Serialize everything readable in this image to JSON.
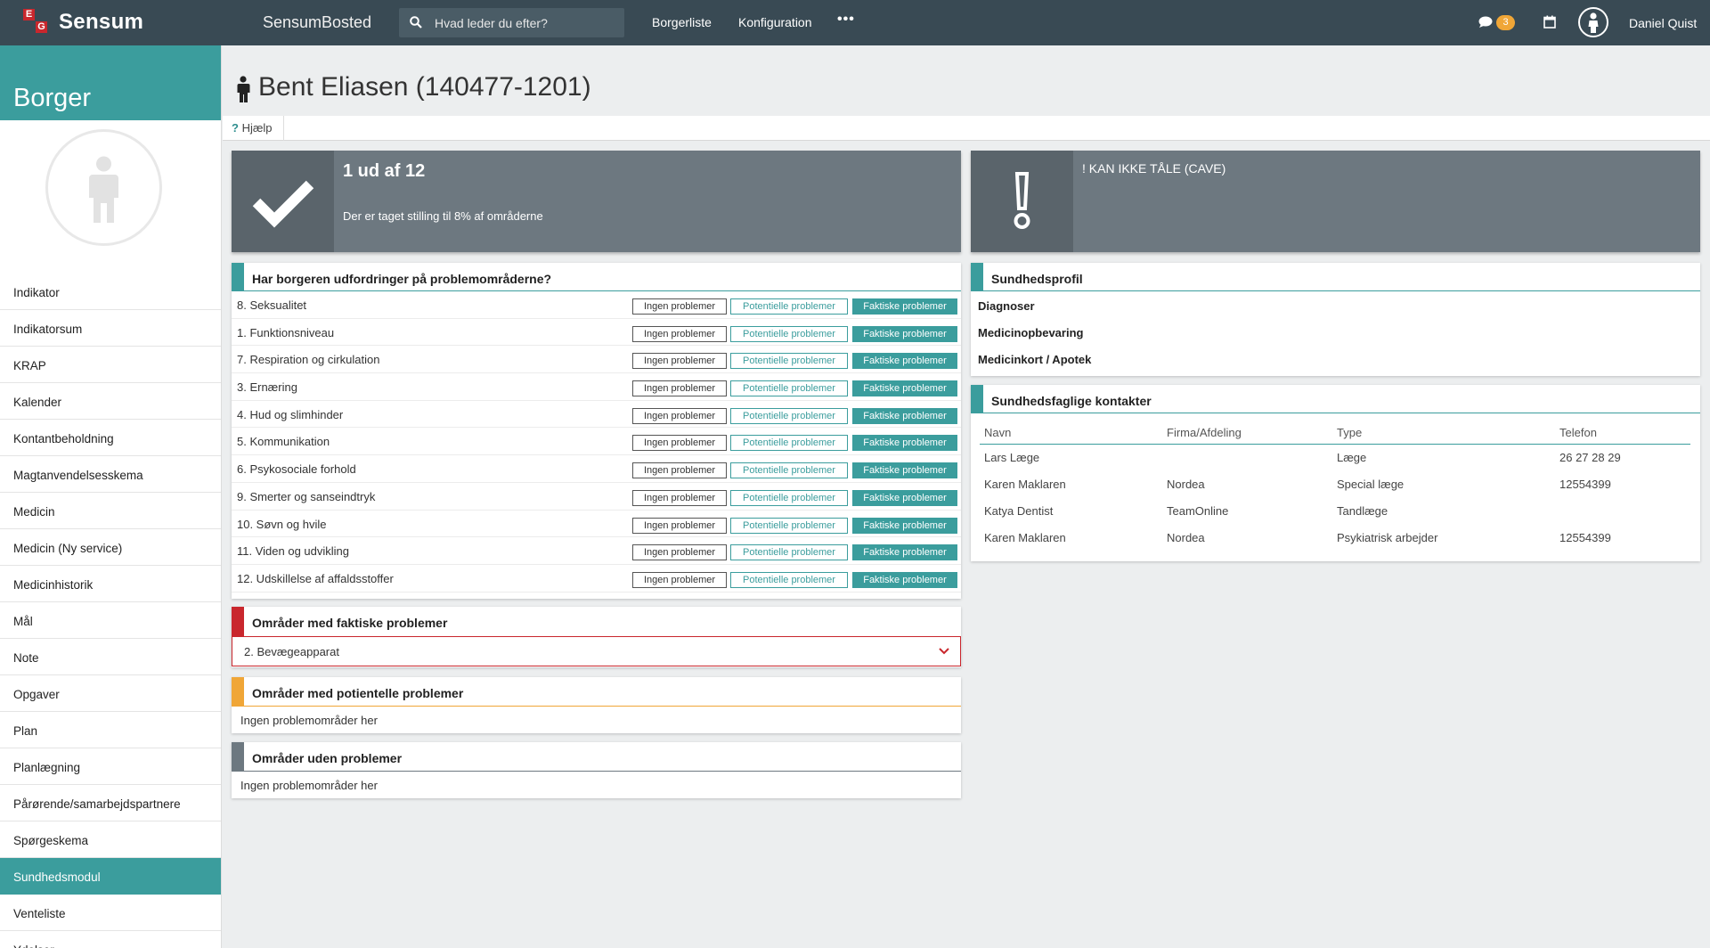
{
  "topbar": {
    "brand": "Sensum",
    "app_title": "SensumBosted",
    "search_placeholder": "Hvad leder du efter?",
    "nav": [
      "Borgerliste",
      "Konfiguration"
    ],
    "more": "•••",
    "messages_count": "3",
    "username": "Daniel Quist"
  },
  "sidebar": {
    "heading": "Borger",
    "items": [
      "Indikator",
      "Indikatorsum",
      "KRAP",
      "Kalender",
      "Kontantbeholdning",
      "Magtanvendelsesskema",
      "Medicin",
      "Medicin (Ny service)",
      "Medicinhistorik",
      "Mål",
      "Note",
      "Opgaver",
      "Plan",
      "Planlægning",
      "Pårørende/samarbejdspartnere",
      "Spørgeskema",
      "Sundhedsmodul",
      "Venteliste",
      "Ydelser"
    ],
    "active": "Sundhedsmodul"
  },
  "page": {
    "title": "Bent Eliasen (140477-1201)",
    "help": "Hjælp"
  },
  "stat_left": {
    "big": "1 ud af 12",
    "small": "Der er taget stilling til 8% af områderne"
  },
  "stat_right": {
    "text": "! KAN IKKE TÅLE (CAVE)"
  },
  "problems": {
    "title": "Har borgeren udfordringer på problemområderne?",
    "btn_none": "Ingen problemer",
    "btn_pot": "Potentielle problemer",
    "btn_act": "Faktiske problemer",
    "rows": [
      "8. Seksualitet",
      "1. Funktionsniveau",
      "7. Respiration og cirkulation",
      "3. Ernæring",
      "4. Hud og slimhinder",
      "5. Kommunikation",
      "6. Psykosociale forhold",
      "9. Smerter og sanseindtryk",
      "10. Søvn og hvile",
      "11. Viden og udvikling",
      "12. Udskillelse af affaldsstoffer"
    ]
  },
  "actual": {
    "title": "Områder med faktiske problemer",
    "item": "2. Bevægeapparat"
  },
  "potential": {
    "title": "Områder med potientelle problemer",
    "empty": "Ingen problemområder her"
  },
  "none": {
    "title": "Områder uden problemer",
    "empty": "Ingen problemområder her"
  },
  "health_profile": {
    "title": "Sundhedsprofil",
    "items": [
      "Diagnoser",
      "Medicinopbevaring",
      "Medicinkort / Apotek"
    ]
  },
  "contacts": {
    "title": "Sundhedsfaglige kontakter",
    "headers": [
      "Navn",
      "Firma/Afdeling",
      "Type",
      "Telefon"
    ],
    "rows": [
      [
        "Lars Læge",
        "",
        "Læge",
        "26 27 28 29"
      ],
      [
        "Karen Maklaren",
        "Nordea",
        "Special læge",
        "12554399"
      ],
      [
        "Katya Dentist",
        "TeamOnline",
        "Tandlæge",
        ""
      ],
      [
        "Karen Maklaren",
        "Nordea",
        "Psykiatrisk arbejder",
        "12554399"
      ]
    ]
  },
  "colors": {
    "teal": "#3b9d9d",
    "topbar": "#394a54",
    "red": "#c9272d",
    "orange": "#f0a637",
    "grey": "#6d7880"
  }
}
